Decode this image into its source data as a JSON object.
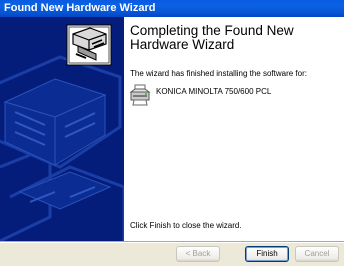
{
  "window": {
    "title": "Found New Hardware Wizard"
  },
  "wizard": {
    "heading_line1": "Completing the Found New",
    "heading_line2": "Hardware Wizard",
    "info_text": "The wizard has finished installing the software for:",
    "device_name": "KONICA MINOLTA 750/600 PCL",
    "finish_hint": "Click Finish to close the wizard."
  },
  "buttons": {
    "back_label": "< Back",
    "finish_label": "Finish",
    "cancel_label": "Cancel"
  },
  "icons": {
    "banner_icon": "hardware-device-icon",
    "printer_icon": "printer-icon"
  },
  "colors": {
    "side_panel": "#041d7a",
    "titlebar": "#0a5ae0"
  }
}
